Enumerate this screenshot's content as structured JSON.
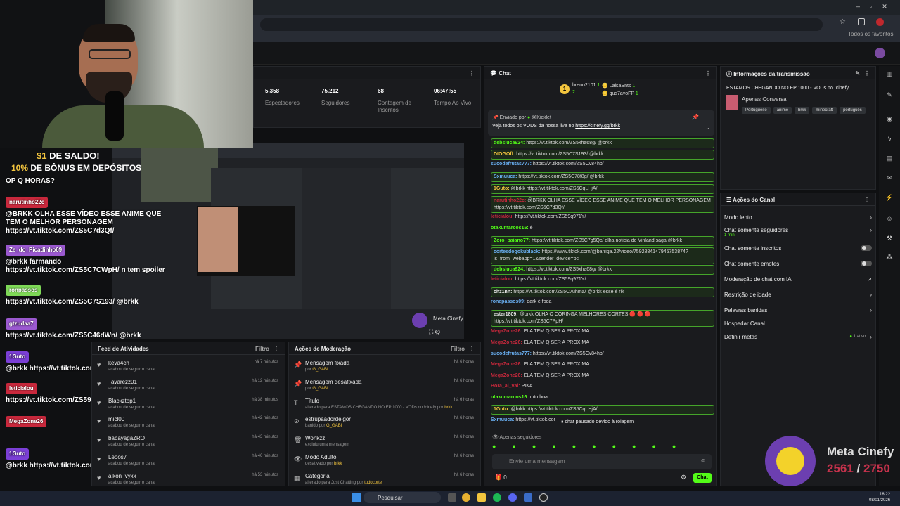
{
  "stats": [
    {
      "value": "5.358",
      "label": "Espectadores"
    },
    {
      "value": "75.212",
      "label": "Seguidores"
    },
    {
      "value": "68",
      "label": "Contagem de Inscritos"
    },
    {
      "value": "06:47:55",
      "label": "Tempo Ao Vivo"
    }
  ],
  "bookmarks_label": "Todos os favoritos",
  "promo": {
    "line1_a": "$1",
    "line1_b": " DE SALDO!",
    "line2_a": "10%",
    "line2_b": " DE BÔNUS EM DEPÓSITOS"
  },
  "overlay_chat": [
    {
      "text": "OP Q HORAS?"
    },
    {
      "user": "narutinho22c",
      "color": "#c8283c",
      "text": "@BRKK OLHA ESSE VÍDEO ESSE ANIME QUE TEM O MELHOR PERSONAGEM https://vt.tiktok.com/ZS5C7d3Qf/"
    },
    {
      "user": "Ze_do_Picadinho69",
      "color": "#9b59d0",
      "text": "@brkk farmando https://vt.tiktok.com/ZS5C7CWpH/ n tem spoiler"
    },
    {
      "user": "ronpassos",
      "color": "#7ed957",
      "text": "https://vt.tiktok.com/ZS5C7S193/ @brkk"
    },
    {
      "user": "gtzudaa7",
      "color": "#9b59d0",
      "text": "https://vt.tiktok.com/ZS5C46dWn/ @brkk"
    },
    {
      "user": "1Guto",
      "color": "#7b3fd6",
      "text": "@brkk https://vt.tiktok.com/ZS5CqLHjA/"
    },
    {
      "user": "leticialou",
      "color": "#c8283c",
      "text": "https://vt.tiktok.com/ZS59q971Y/"
    },
    {
      "user": "MegaZone26",
      "color": "#c8283c",
      "text": ""
    },
    {
      "user": "1Guto",
      "color": "#7b3fd6",
      "text": "@brkk https://vt.tiktok.com/ZS5CqLHjA/"
    }
  ],
  "chat": {
    "title": "Chat",
    "top_users": [
      {
        "name": "breno2101",
        "count": "1"
      },
      {
        "name": "LaisaSnts",
        "count": "1"
      },
      {
        "name": "gus7avoFP",
        "count": "1"
      }
    ],
    "top_count": "2",
    "pinned_by": "Enviado por",
    "pinned_user": "@Kicklet",
    "pinned_text": "Veja todos os VODS da nossa live no ",
    "pinned_link": "https://cinefy.gg/brkk",
    "messages": [
      {
        "user": "debsluca924:",
        "color": "#53fc18",
        "text": "https://vt.tiktok.com/ZS5xha68g/ @brkk",
        "hl": true
      },
      {
        "user": "DIOGOff:",
        "color": "#f3c53e",
        "text": "https://vt.tiktok.com/ZS5C7S193/ @brkk",
        "hl": true
      },
      {
        "user": "sucodefrutas777:",
        "color": "#6ab0f3",
        "text": "https://vt.tiktok.com/ZS5Cv84hb/",
        "hl": false
      },
      {
        "user": "Sxmuuca:",
        "color": "#6ab0f3",
        "text": "https://vt.tiktok.com/ZS5C78f8g/ @brkk",
        "hl": true
      },
      {
        "user": "1Guto:",
        "color": "#f3c53e",
        "text": "@brkk https://vt.tiktok.com/ZS5CqLHjA/",
        "hl": true
      },
      {
        "user": "narutinho22c:",
        "color": "#c8283c",
        "text": "@BRKK OLHA ESSE VÍDEO ESSE ANIME QUE TEM O MELHOR PERSONAGEM https://vt.tiktok.com/ZS5C7d3Qf/",
        "hl": true
      },
      {
        "user": "leticialou:",
        "color": "#c8283c",
        "text": "https://vt.tiktok.com/ZS59q971Y/",
        "hl": false
      },
      {
        "user": "otakumarcos16:",
        "color": "#53fc18",
        "text": "é",
        "hl": false
      },
      {
        "user": "Zoro_baiano77:",
        "color": "#53fc18",
        "text": "https://vt.tiktok.com/ZS5C7g5Qc/ olha noticia de Vinland saga @brkk",
        "hl": true
      },
      {
        "user": "cortesdogokublack:",
        "color": "#6ab0f3",
        "text": "https://www.tiktok.com/@barriga.22/video/7592884147945753874?is_from_webapp=1&sender_device=pc",
        "hl": true
      },
      {
        "user": "debsluca924:",
        "color": "#53fc18",
        "text": "https://vt.tiktok.com/ZS5xha68g/ @brkk",
        "hl": true
      },
      {
        "user": "leticialou:",
        "color": "#c8283c",
        "text": "https://vt.tiktok.com/ZS59q971Y/",
        "hl": false
      },
      {
        "user": "chz1nn:",
        "color": "#e6e6e6",
        "text": "https://vt.tiktok.com/ZS5C7uhma/ @brkk esse é rlk",
        "hl": true
      },
      {
        "user": "ronepassos09:",
        "color": "#6ab0f3",
        "text": "dark é foda",
        "hl": false
      },
      {
        "user": "ester1809:",
        "color": "#e6e6e6",
        "text": "@brkk OLHA O CORINGA MELHORES CORTES 🔴 🔴 🔴 https://vt.tiktok.com/ZS5C7PpH/",
        "hl": true
      },
      {
        "user": "MegaZone26:",
        "color": "#c8283c",
        "text": "ELA TEM Q SER A PROXIMA",
        "hl": false
      },
      {
        "user": "MegaZone26:",
        "color": "#c8283c",
        "text": "ELA TEM Q SER A PROXIMA",
        "hl": false
      },
      {
        "user": "sucodefrutas777:",
        "color": "#6ab0f3",
        "text": "https://vt.tiktok.com/ZS5Cv84hb/",
        "hl": false
      },
      {
        "user": "MegaZone26:",
        "color": "#c8283c",
        "text": "ELA TEM Q SER A PROXIMA",
        "hl": false
      },
      {
        "user": "MegaZone26:",
        "color": "#c8283c",
        "text": "ELA TEM Q SER A PROXIMA",
        "hl": false
      },
      {
        "user": "Bora_ai_vai:",
        "color": "#c8283c",
        "text": "PIKA",
        "hl": false
      },
      {
        "user": "otakumarcos16:",
        "color": "#53fc18",
        "text": "mto boa",
        "hl": false
      },
      {
        "user": "1Guto:",
        "color": "#f3c53e",
        "text": "@brkk https://vt.tiktok.com/ZS5CqLHjA/",
        "hl": true
      },
      {
        "user": "Sxmuuca:",
        "color": "#6ab0f3",
        "text": "https://vt.tiktok.com/",
        "hl": false
      }
    ],
    "paused": "chat pausado devido à rolagem",
    "mode": "Apenas seguidores",
    "input_placeholder": "Envie uma mensagem",
    "send_label": "Chat",
    "count": "0"
  },
  "info": {
    "title": "Informações da transmissão",
    "stream_title": "ESTAMOS CHEGANDO NO EP 1000 - VODs no !cinefy",
    "category": "Apenas Conversa",
    "tags": [
      "Portuguese",
      "anime",
      "brkk",
      "minecraft",
      "português"
    ]
  },
  "actions": {
    "title": "Ações do Canal",
    "items": [
      {
        "label": "Modo lento",
        "kind": "chevron"
      },
      {
        "label": "Chat somente seguidores",
        "sub": "1 min",
        "kind": "chevron"
      },
      {
        "label": "Chat somente inscritos",
        "kind": "toggle"
      },
      {
        "label": "Chat somente emotes",
        "kind": "toggle"
      },
      {
        "label": "Moderação de chat com IA",
        "kind": "ext"
      },
      {
        "label": "Restrição de idade",
        "kind": "chevron"
      },
      {
        "label": "Palavras banidas",
        "kind": "chevron"
      },
      {
        "label": "Hospedar Canal",
        "kind": "none"
      },
      {
        "label": "Definir metas",
        "value": "1 ativo",
        "kind": "chevron"
      }
    ]
  },
  "feed": {
    "title": "Feed de Atividades",
    "filter": "Filtro",
    "items": [
      {
        "name": "keva4ch",
        "sub": "acabou de seguir o canal",
        "time": "há 7 minutos"
      },
      {
        "name": "Tavarezz01",
        "sub": "acabou de seguir o canal",
        "time": "há 12 minutos"
      },
      {
        "name": "Blackztop1",
        "sub": "acabou de seguir o canal",
        "time": "há 38 minutos"
      },
      {
        "name": "micl00",
        "sub": "acabou de seguir o canal",
        "time": "há 42 minutos"
      },
      {
        "name": "babayagaZRO",
        "sub": "acabou de seguir o canal",
        "time": "há 43 minutos"
      },
      {
        "name": "Leoos7",
        "sub": "acabou de seguir o canal",
        "time": "há 46 minutos"
      },
      {
        "name": "aikon_vyxx",
        "sub": "acabou de seguir o canal",
        "time": "há 53 minutos"
      }
    ]
  },
  "mod": {
    "title": "Ações de Moderação",
    "filter": "Filtro",
    "items": [
      {
        "name": "Mensagem fixada",
        "sub": "por ",
        "who": "G_GABI",
        "time": "há 6 horas",
        "icon": "📌"
      },
      {
        "name": "Mensagem desafixada",
        "sub": "por ",
        "who": "G_GABI",
        "time": "há 6 horas",
        "icon": "📌"
      },
      {
        "name": "Título",
        "sub": "alterado para ESTAMOS CHEGANDO NO EP 1000 - VODs no !cinefy por ",
        "who": "brkk",
        "time": "há 6 horas",
        "icon": "T"
      },
      {
        "name": "estrupaadordeigor",
        "sub": "banido por ",
        "who": "G_GABI",
        "time": "há 6 horas",
        "icon": "⊘"
      },
      {
        "name": "Wonkzz",
        "sub": "excluiu uma mensagem",
        "who": "",
        "time": "há 6 horas",
        "icon": "🗑"
      },
      {
        "name": "Modo Adulto",
        "sub": "desativado por ",
        "who": "brkk",
        "time": "há 6 horas",
        "icon": "👁"
      },
      {
        "name": "Categoria",
        "sub": "alterado para Just Chatting por ",
        "who": "tudocorte",
        "time": "há 6 horas",
        "icon": "▦"
      }
    ]
  },
  "preview": {
    "meta_label": "Meta Cinefy"
  },
  "meta": {
    "title": "Meta Cinefy",
    "current": "2561",
    "sep": " / ",
    "goal": "2750"
  },
  "taskbar": {
    "search": "Pesquisar",
    "time": "18:22",
    "date": "08/01/2026"
  },
  "colors": {
    "accent": "#53fc18",
    "gold": "#f3c53e",
    "meta": "#c6324c"
  }
}
